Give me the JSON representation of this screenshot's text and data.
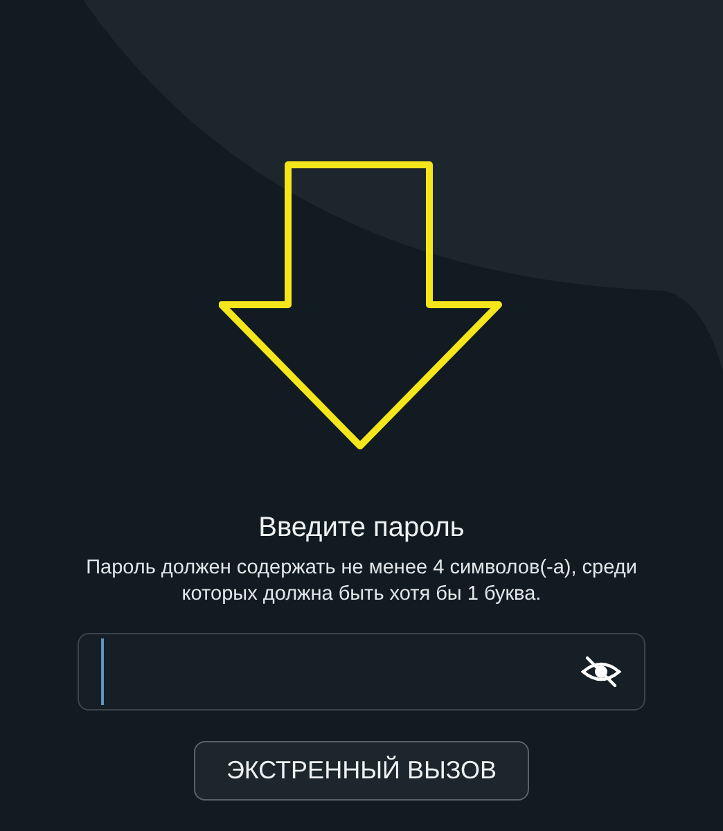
{
  "prompt": {
    "title": "Введите пароль",
    "hint": "Пароль должен содержать не менее 4 символов(-а), среди которых должна быть хотя бы 1 буква."
  },
  "password_field": {
    "password_visible": false
  },
  "emergency_button": {
    "label": "ЭКСТРЕННЫЙ ВЫЗОВ"
  }
}
